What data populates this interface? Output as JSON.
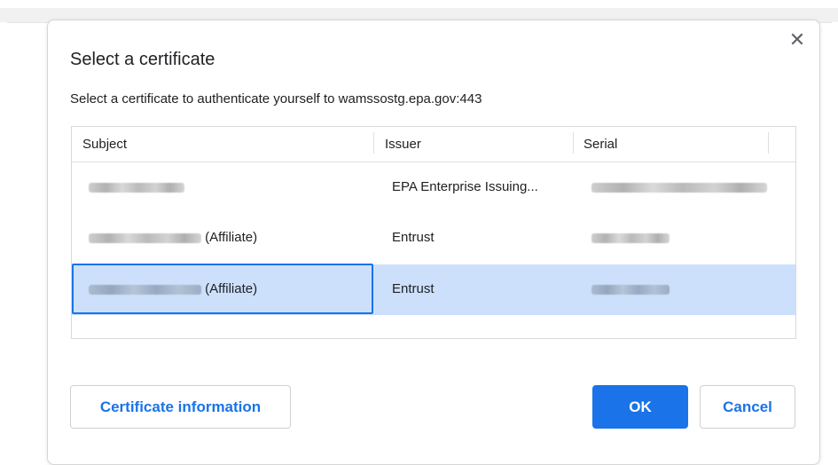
{
  "dialog": {
    "close_glyph": "✕",
    "title": "Select a certificate",
    "description": "Select a certificate to authenticate yourself to wamssostg.epa.gov:443"
  },
  "table": {
    "columns": [
      "Subject",
      "Issuer",
      "Serial"
    ],
    "rows": [
      {
        "subject_suffix": "",
        "issuer": "EPA Enterprise Issuing...",
        "selected": false
      },
      {
        "subject_suffix": "(Affiliate)",
        "issuer": "Entrust",
        "selected": false
      },
      {
        "subject_suffix": "(Affiliate)",
        "issuer": "Entrust",
        "selected": true
      }
    ]
  },
  "buttons": {
    "certificate_info": "Certificate information",
    "ok": "OK",
    "cancel": "Cancel"
  },
  "colors": {
    "accent": "#1a73e8",
    "selection": "#cce0fb"
  }
}
